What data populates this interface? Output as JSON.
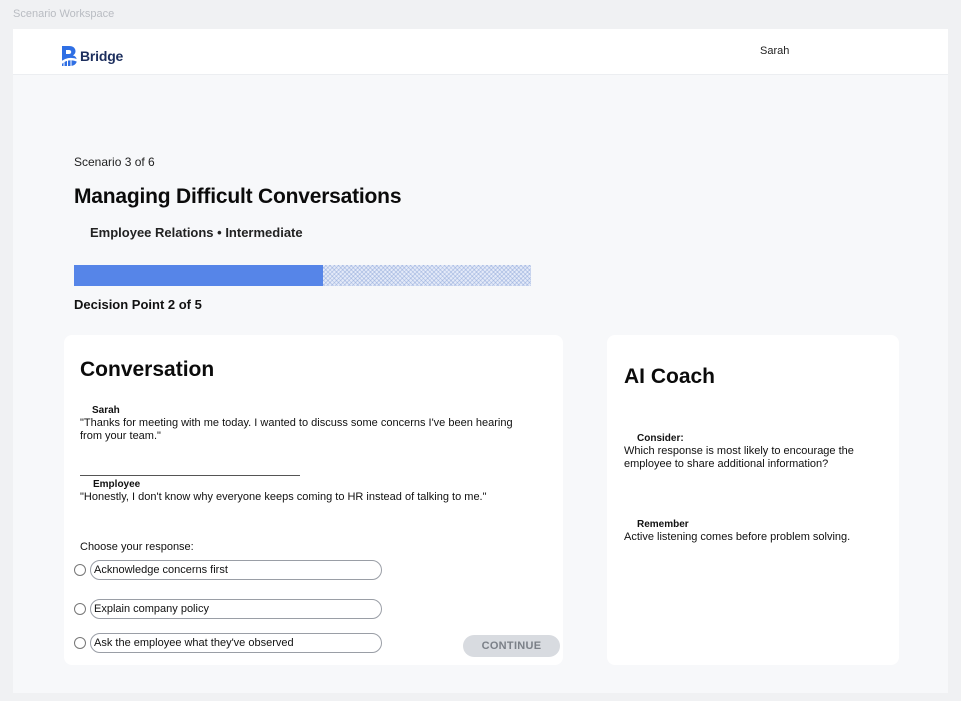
{
  "window": {
    "label": "Scenario Workspace"
  },
  "header": {
    "logo_text": "Bridge",
    "user_name": "Sarah",
    "brand_color": "#1d2f5e"
  },
  "scenario": {
    "count": "Scenario 3 of 6",
    "title": "Managing Difficult Conversations",
    "subtitle": "Employee Relations • Intermediate",
    "progress_fraction": 0.545,
    "progress_color": "#5685e8",
    "decision_point": "Decision Point 2 of 5"
  },
  "conversation": {
    "title": "Conversation",
    "messages": [
      {
        "speaker": "Sarah",
        "text": "\"Thanks for meeting with me today. I wanted to discuss some concerns I've been hearing from your team.\""
      },
      {
        "speaker": "Employee",
        "text": "\"Honestly, I don't know why everyone keeps coming to HR instead of talking to me.\""
      }
    ],
    "choose_label": "Choose your response:",
    "options": [
      {
        "label": "Acknowledge concerns first",
        "selected": false
      },
      {
        "label": "Explain company policy",
        "selected": false
      },
      {
        "label": "Ask the employee what they've observed",
        "selected": false
      }
    ],
    "continue_label": "CONTINUE"
  },
  "coach": {
    "title": "AI Coach",
    "tips": [
      {
        "heading": "Consider:",
        "text": "Which response is most likely to encourage the employee to share additional information?"
      },
      {
        "heading": "Remember",
        "text": "Active listening comes before problem solving."
      }
    ]
  }
}
